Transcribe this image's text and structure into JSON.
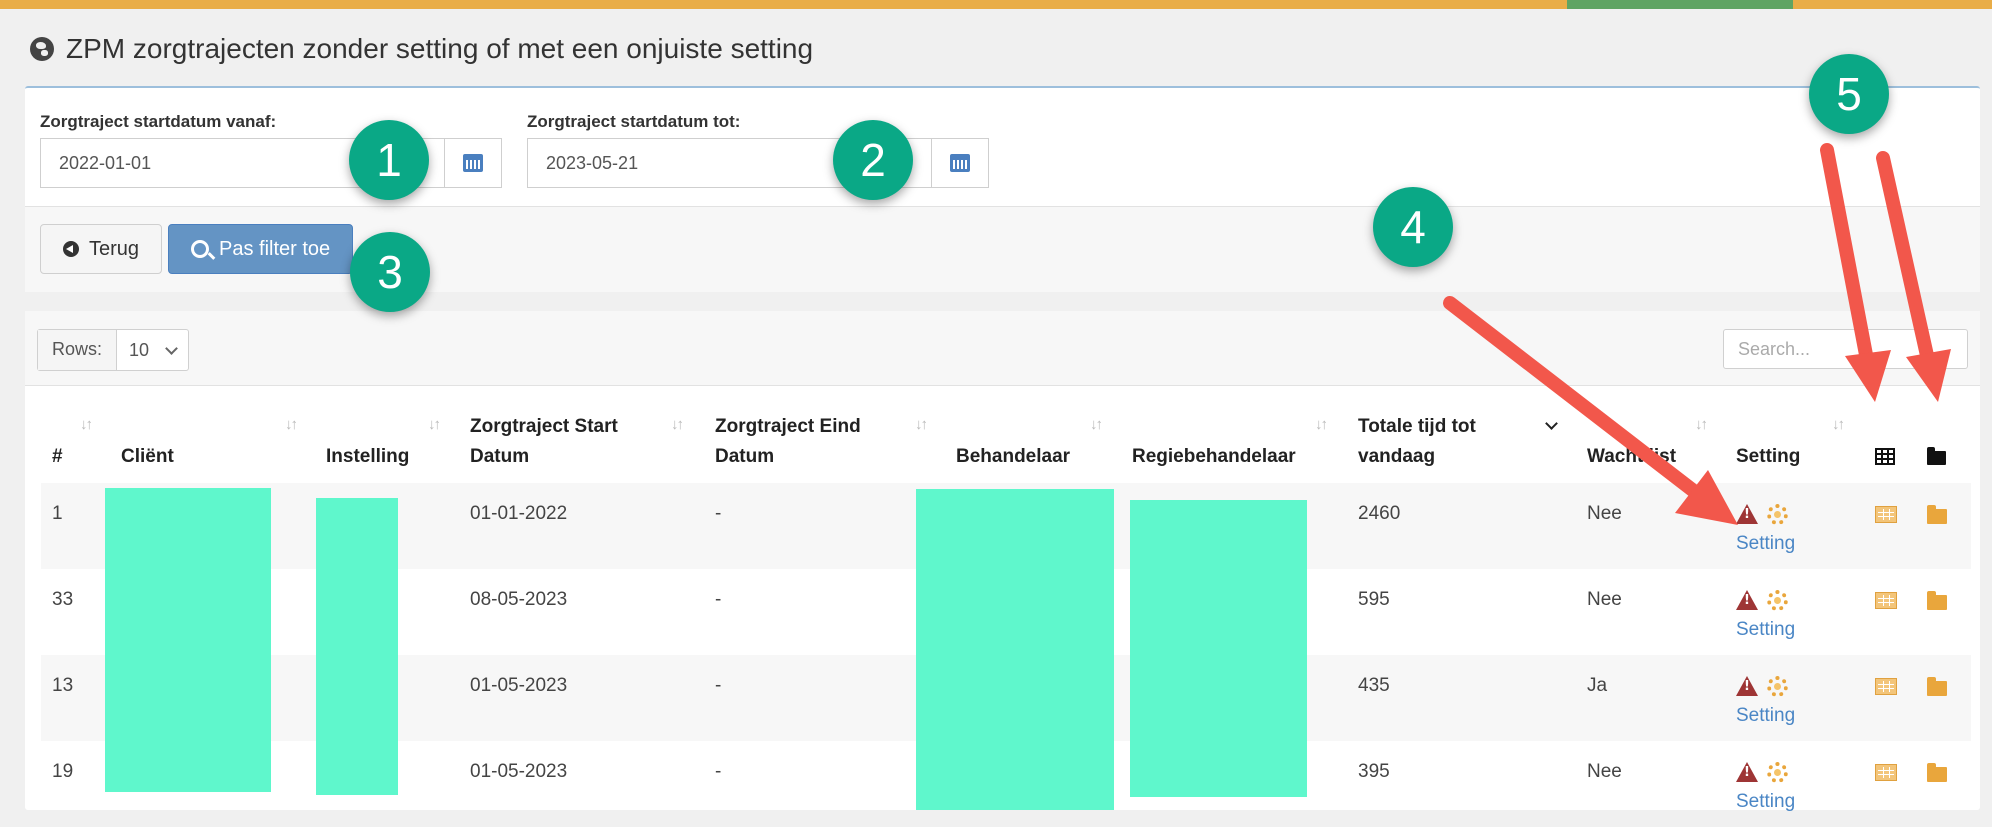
{
  "page": {
    "title": "ZPM zorgtrajecten zonder setting of met een onjuiste setting"
  },
  "filters": {
    "start_from": {
      "label": "Zorgtraject startdatum vanaf:",
      "value": "2022-01-01"
    },
    "start_to": {
      "label": "Zorgtraject startdatum tot:",
      "value": "2023-05-21"
    },
    "back_label": "Terug",
    "apply_label": "Pas filter toe"
  },
  "table": {
    "rows_label": "Rows:",
    "rows_value": "10",
    "search_placeholder": "Search...",
    "headers": {
      "num": "#",
      "client": "Cliënt",
      "institution": "Instelling",
      "start_1": "Zorgtraject Start",
      "start_2": "Datum",
      "end_1": "Zorgtraject Eind",
      "end_2": "Datum",
      "therapist": "Behandelaar",
      "director": "Regiebehandelaar",
      "total_1": "Totale tijd tot",
      "total_2": "vandaag",
      "waitlist": "Wachtlijst",
      "setting": "Setting"
    },
    "rows": [
      {
        "num": "1",
        "start": "01-01-2022",
        "end": "-",
        "total": "2460",
        "waitlist": "Nee",
        "setting_link": "Setting"
      },
      {
        "num": "33",
        "start": "08-05-2023",
        "end": "-",
        "total": "595",
        "waitlist": "Nee",
        "setting_link": "Setting"
      },
      {
        "num": "13",
        "start": "01-05-2023",
        "end": "-",
        "total": "435",
        "waitlist": "Ja",
        "setting_link": "Setting"
      },
      {
        "num": "19",
        "start": "01-05-2023",
        "end": "-",
        "total": "395",
        "waitlist": "Nee",
        "setting_link": "Setting"
      }
    ]
  },
  "annotations": {
    "c1": "1",
    "c2": "2",
    "c3": "3",
    "c4": "4",
    "c5": "5"
  },
  "colors": {
    "accent": "#e9ad47",
    "callout": "#0aa886",
    "arrow": "#f2574b",
    "redaction": "#5ff7cc",
    "link": "#4a86c5"
  }
}
